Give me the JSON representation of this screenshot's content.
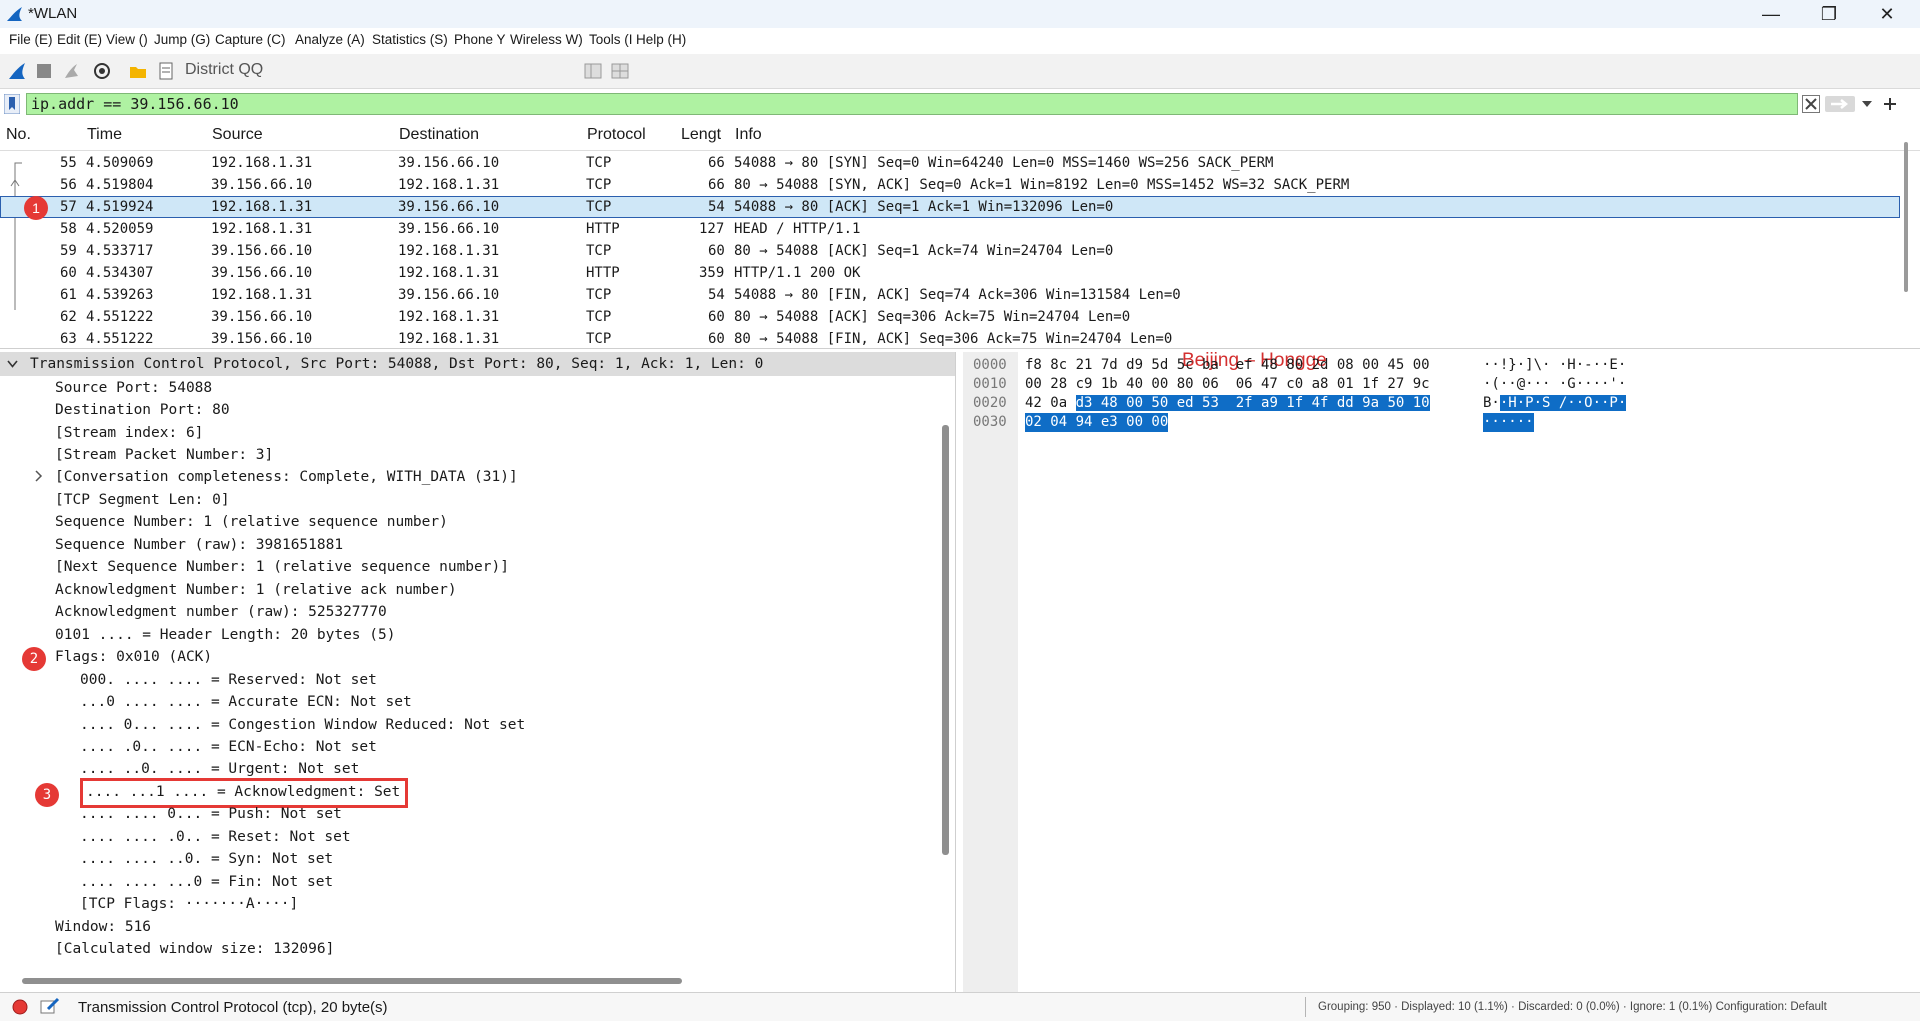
{
  "window": {
    "title": "*WLAN",
    "minimize": "—",
    "restore": "❐",
    "close": "✕"
  },
  "menu": [
    "File (E)",
    "Edit (E)",
    "View ()",
    "Jump (G)",
    "Capture (C)",
    "Analyze (A)",
    "Statistics (S)",
    "Phone Y",
    "Wireless W)",
    "Tools (I",
    "Help (H)"
  ],
  "toolbar": {
    "label": "District QQ"
  },
  "filter": {
    "value": "ip.addr == 39.156.66.10"
  },
  "packet_list": {
    "columns": [
      "No.",
      "Time",
      "Source",
      "Destination",
      "Protocol",
      "Lengt",
      "Info"
    ],
    "rows": [
      {
        "no": "55",
        "time": "4.509069",
        "src": "192.168.1.31",
        "dst": "39.156.66.10",
        "proto": "TCP",
        "len": "66",
        "info": "54088 → 80 [SYN] Seq=0 Win=64240 Len=0 MSS=1460 WS=256 SACK_PERM"
      },
      {
        "no": "56",
        "time": "4.519804",
        "src": "39.156.66.10",
        "dst": "192.168.1.31",
        "proto": "TCP",
        "len": "66",
        "info": "80 → 54088 [SYN, ACK] Seq=0 Ack=1 Win=8192 Len=0 MSS=1452 WS=32 SACK_PERM"
      },
      {
        "no": "57",
        "time": "4.519924",
        "src": "192.168.1.31",
        "dst": "39.156.66.10",
        "proto": "TCP",
        "len": "54",
        "info": "54088 → 80 [ACK] Seq=1 Ack=1 Win=132096 Len=0"
      },
      {
        "no": "58",
        "time": "4.520059",
        "src": "192.168.1.31",
        "dst": "39.156.66.10",
        "proto": "HTTP",
        "len": "127",
        "info": "HEAD / HTTP/1.1"
      },
      {
        "no": "59",
        "time": "4.533717",
        "src": "39.156.66.10",
        "dst": "192.168.1.31",
        "proto": "TCP",
        "len": "60",
        "info": "80 → 54088 [ACK] Seq=1 Ack=74 Win=24704 Len=0"
      },
      {
        "no": "60",
        "time": "4.534307",
        "src": "39.156.66.10",
        "dst": "192.168.1.31",
        "proto": "HTTP",
        "len": "359",
        "info": "HTTP/1.1 200 OK"
      },
      {
        "no": "61",
        "time": "4.539263",
        "src": "192.168.1.31",
        "dst": "39.156.66.10",
        "proto": "TCP",
        "len": "54",
        "info": "54088 → 80 [FIN, ACK] Seq=74 Ack=306 Win=131584 Len=0"
      },
      {
        "no": "62",
        "time": "4.551222",
        "src": "39.156.66.10",
        "dst": "192.168.1.31",
        "proto": "TCP",
        "len": "60",
        "info": "80 → 54088 [ACK] Seq=306 Ack=75 Win=24704 Len=0"
      },
      {
        "no": "63",
        "time": "4.551222",
        "src": "39.156.66.10",
        "dst": "192.168.1.31",
        "proto": "TCP",
        "len": "60",
        "info": "80 → 54088 [FIN, ACK] Seq=306 Ack=75 Win=24704 Len=0"
      }
    ]
  },
  "annotations": {
    "b1": "1",
    "b2": "2",
    "b3": "3",
    "watermark": "Beijing – Hongge",
    "highlight_color": "#e53935"
  },
  "details": {
    "header": "Transmission Control Protocol, Src Port: 54088, Dst Port: 80, Seq: 1, Ack: 1, Len: 0",
    "lines": [
      "Source Port: 54088",
      "Destination Port: 80",
      "[Stream index: 6]",
      "[Stream Packet Number: 3]",
      "[Conversation completeness: Complete, WITH_DATA (31)]",
      "[TCP Segment Len: 0]",
      "Sequence Number: 1    (relative sequence number)",
      "Sequence Number (raw): 3981651881",
      "[Next Sequence Number: 1    (relative sequence number)]",
      "Acknowledgment Number: 1    (relative ack number)",
      "Acknowledgment number (raw): 525327770",
      "0101 .... = Header Length: 20 bytes (5)",
      "Flags: 0x010 (ACK)",
      "000. .... .... = Reserved: Not set",
      "...0 .... .... = Accurate ECN: Not set",
      ".... 0... .... = Congestion Window Reduced: Not set",
      ".... .0.. .... = ECN-Echo: Not set",
      ".... ..0. .... = Urgent: Not set",
      ".... ...1 .... = Acknowledgment: Set",
      ".... .... 0... = Push: Not set",
      ".... .... .0.. = Reset: Not set",
      ".... .... ..0. = Syn: Not set",
      ".... .... ...0 = Fin: Not set",
      "[TCP Flags: ·······A····]",
      "Window: 516",
      "[Calculated window size: 132096]"
    ]
  },
  "hex": {
    "offsets": [
      "0000",
      "0010",
      "0020",
      "0030"
    ],
    "r0_hex": "f8 8c 21 7d d9 5d 5c ba  ef 48 80 2d 08 00 45 00",
    "r0_ascii": "··!}·]\\· ·H·-··E·",
    "r1_hex": "00 28 c9 1b 40 00 80 06  06 47 c0 a8 01 1f 27 9c",
    "r1_ascii": "·(··@··· ·G····'·",
    "r2_hex_a": "42 0a ",
    "r2_hex_b": "d3 48 00 50 ed 53  2f a9 1f 4f dd 9a 50 10",
    "r2_ascii_a": "B·",
    "r2_ascii_b": "·H·P·S /··O··P·",
    "r3_hex_b": "02 04 94 e3 00 00",
    "r3_ascii_b": "······"
  },
  "status": {
    "text": "Transmission Control Protocol (tcp), 20 byte(s)",
    "right": "Grouping: 950 · Displayed: 10 (1.1%) · Discarded: 0 (0.0%) · Ignore: 1 (0.1%) Configuration: Default"
  }
}
